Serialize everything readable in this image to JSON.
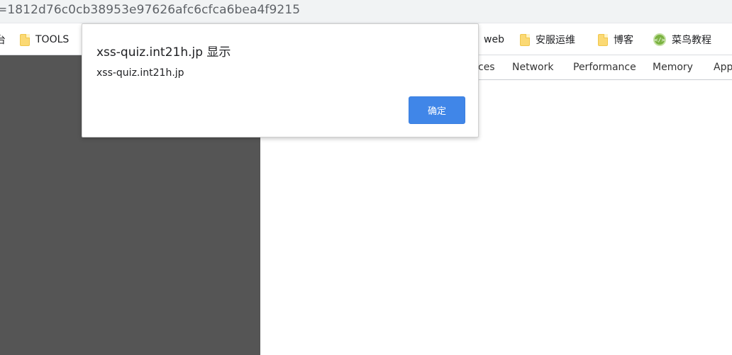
{
  "address_bar": {
    "url_fragment": "=1812d76c0cb38953e97626afc6cfca6bea4f9215"
  },
  "bookmarks": {
    "items": [
      {
        "label": "台",
        "icon": "none"
      },
      {
        "label": "TOOLS",
        "icon": "folder-icon"
      },
      {
        "label": "web",
        "icon": "none"
      },
      {
        "label": "安服运维",
        "icon": "folder-icon"
      },
      {
        "label": "博客",
        "icon": "folder-icon"
      },
      {
        "label": "菜鸟教程",
        "icon": "code-icon",
        "icon_glyph": "</>"
      }
    ]
  },
  "devtools": {
    "tabs": [
      {
        "label": "ces"
      },
      {
        "label": "Network"
      },
      {
        "label": "Performance"
      },
      {
        "label": "Memory"
      },
      {
        "label": "App"
      }
    ]
  },
  "dialog": {
    "title": "xss-quiz.int21h.jp 显示",
    "message": "xss-quiz.int21h.jp",
    "ok_label": "确定"
  },
  "colors": {
    "left_panel": "#555555",
    "ok_button": "#4086e8",
    "folder": "#fbd974"
  }
}
